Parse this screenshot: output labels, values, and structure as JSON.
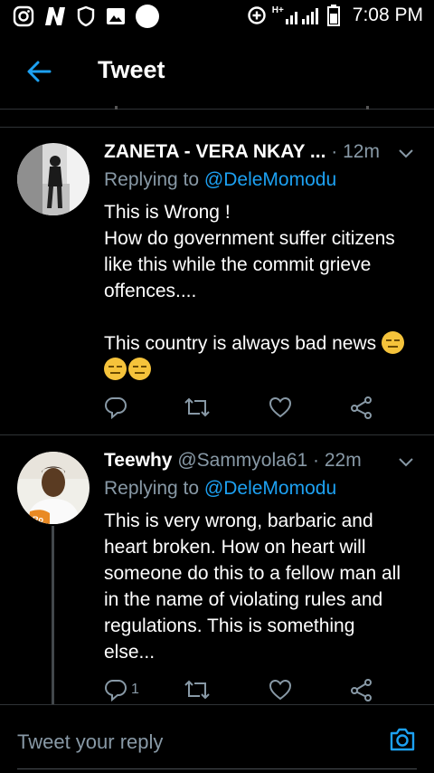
{
  "status_bar": {
    "time": "7:08 PM",
    "network": "H+"
  },
  "header": {
    "title": "Tweet"
  },
  "tweets": [
    {
      "name": "ZANETA - VERA NKAY ...",
      "handle": "",
      "time": "· 12m",
      "replying_label": "Replying to",
      "replying_to": "@DeleMomodu",
      "lines": [
        "This is Wrong !",
        "How do government suffer citizens",
        "like this while the commit grieve",
        "offences....",
        "",
        "This country is always bad news"
      ],
      "emoji_icon": "expressionless-face-icon",
      "actions": {
        "replies": "",
        "retweets": "",
        "likes": ""
      }
    },
    {
      "name": "Teewhy",
      "handle": "@Sammyola61",
      "time": "· 22m",
      "replying_label": "Replying to",
      "replying_to": "@DeleMomodu",
      "lines": [
        "This is very wrong, barbaric and",
        "heart broken. How on heart will",
        "someone do this to a fellow man all",
        "in the name of violating rules and",
        "regulations. This is something",
        "else..."
      ],
      "actions": {
        "replies": "1",
        "retweets": "",
        "likes": ""
      }
    }
  ],
  "composer": {
    "placeholder": "Tweet your reply"
  },
  "colors": {
    "accent": "#1da1f2",
    "secondary_text": "#8899a6",
    "background": "#000000",
    "divider": "#2f3336"
  }
}
